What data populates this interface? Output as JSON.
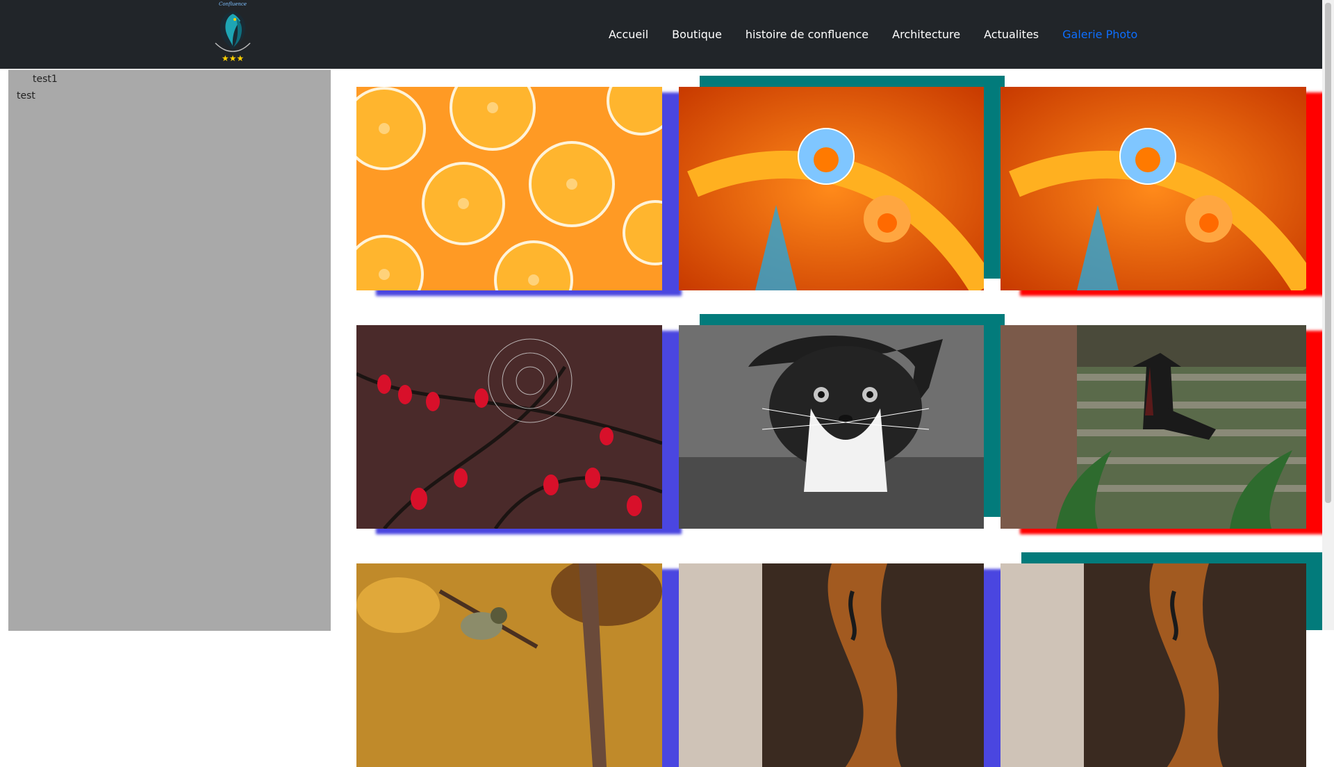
{
  "header": {
    "logo_text": "Confluence",
    "nav": [
      {
        "label": "Accueil",
        "active": false
      },
      {
        "label": "Boutique",
        "active": false
      },
      {
        "label": "histoire de confluence",
        "active": false
      },
      {
        "label": "Architecture",
        "active": false
      },
      {
        "label": "Actualites",
        "active": false
      },
      {
        "label": "Galerie Photo",
        "active": true
      }
    ],
    "active_color": "#0d6efd"
  },
  "sidebar": {
    "items": [
      {
        "label": "test1"
      },
      {
        "label": "test"
      }
    ]
  },
  "gallery": {
    "photos": [
      {
        "subject": "orange-slices",
        "accent": "blue-shadow"
      },
      {
        "subject": "water-drops-on-orange-petal",
        "accent": "teal-frame"
      },
      {
        "subject": "water-drops-on-orange-petal",
        "accent": "red-shadow"
      },
      {
        "subject": "red-berries-spider-web",
        "accent": "blue-shadow"
      },
      {
        "subject": "black-and-white-cat",
        "accent": "teal-frame"
      },
      {
        "subject": "woman-on-stairs",
        "accent": "red-shadow"
      },
      {
        "subject": "bird-on-branch",
        "accent": "blue-shadow"
      },
      {
        "subject": "cello-close-up",
        "accent": "blue-shadow"
      },
      {
        "subject": "cello-close-up",
        "accent": "teal-frame"
      }
    ],
    "colors": {
      "blue": "#4a46e0",
      "teal": "#027b7b",
      "red": "#ff0000"
    }
  }
}
